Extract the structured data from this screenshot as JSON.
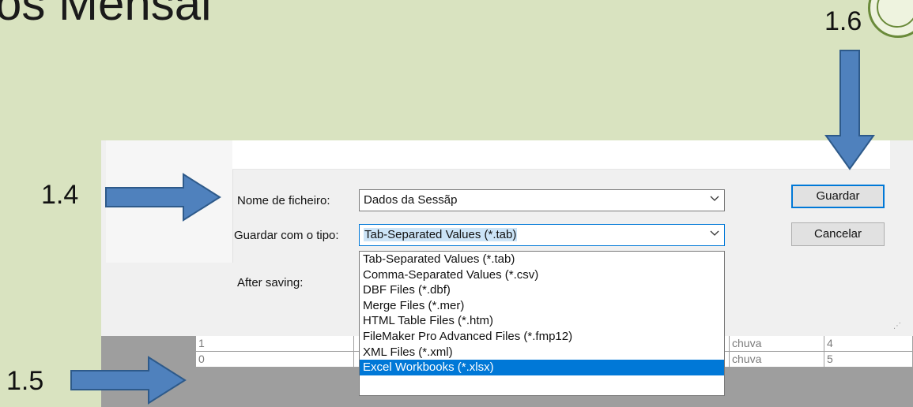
{
  "slide": {
    "title_fragment": "os Mensal",
    "callouts": [
      "1.4",
      "1.5",
      "1.6"
    ]
  },
  "dialog": {
    "filename_label": "Nome de ficheiro:",
    "filename_value": "Dados da Sessãp",
    "savetype_label": "Guardar com o tipo:",
    "savetype_value": "Tab-Separated Values (*.tab)",
    "after_saving_label": "After saving:",
    "save_button": "Guardar",
    "cancel_button": "Cancelar",
    "resize_grip_glyph": "⋰"
  },
  "dropdown": {
    "options": [
      "Tab-Separated Values (*.tab)",
      "Comma-Separated Values (*.csv)",
      "DBF Files (*.dbf)",
      "Merge Files (*.mer)",
      "HTML Table Files (*.htm)",
      "FileMaker Pro Advanced Files (*.fmp12)",
      "XML Files (*.xml)",
      "Excel Workbooks (*.xlsx)"
    ],
    "selected_index": 7
  },
  "table": {
    "rows": [
      {
        "c1": "1",
        "c2": "chuva",
        "c3": "4"
      },
      {
        "c1": "0",
        "c2": "chuva",
        "c3": "5"
      }
    ]
  },
  "colors": {
    "background": "#d9e3c0",
    "arrow_fill": "#4f81bd",
    "arrow_stroke": "#2e5a8a",
    "selection": "#0078d7"
  },
  "icons": [
    "arrow-right-icon",
    "arrow-down-icon",
    "chevron-down-icon",
    "resize-grip-icon",
    "logo-icon"
  ]
}
